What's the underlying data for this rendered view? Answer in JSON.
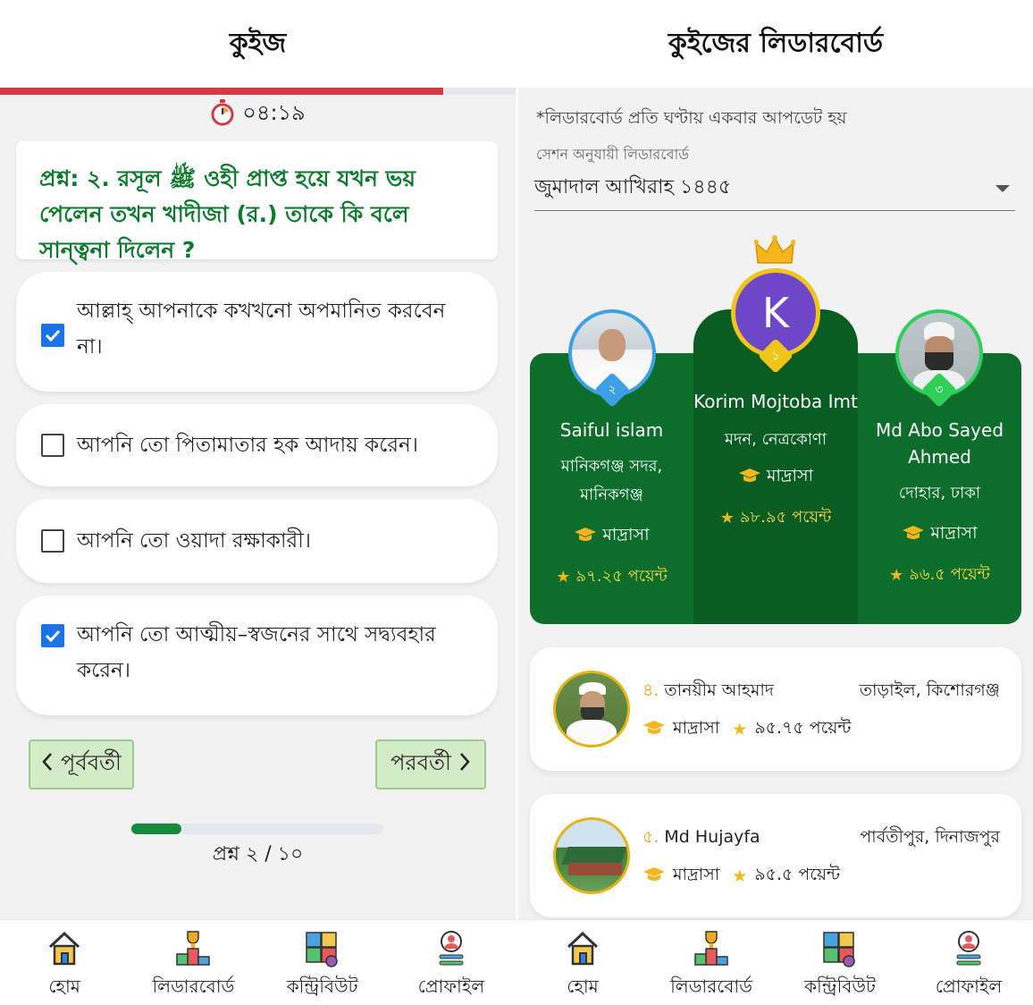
{
  "quiz": {
    "title": "কুইজ",
    "progress_fraction": 0.86,
    "timer": "০৪:১৯",
    "question": "প্রশ্ন: ২. রসূল ﷺ ওহী প্রাপ্ত হয়ে যখন ভয় পেলেন তখন খাদীজা (র.) তাকে কি বলে সান্ত্বনা দিলেন ?",
    "options": [
      {
        "text": "আল্লাহ্ আপনাকে কখখনো অপমানিত করবেন না।",
        "checked": true
      },
      {
        "text": "আপনি তো পিতামাতার হক আদায় করেন।",
        "checked": false
      },
      {
        "text": "আপনি তো ওয়াদা রক্ষাকারী।",
        "checked": false
      },
      {
        "text": "আপনি তো আত্মীয়–স্বজনের সাথে সদ্ব্যবহার করেন।",
        "checked": true
      }
    ],
    "prev_label": "পূর্ববর্তী",
    "next_label": "পরবর্তী",
    "question_progress_fraction": 0.2,
    "question_counter": "প্রশ্ন ২ / ১০"
  },
  "leaderboard": {
    "title": "কুইজের লিডারবোর্ড",
    "note": "*লিডারবোর্ড প্রতি ঘণ্টায় একবার আপডেট হয়",
    "session_label": "সেশন অনুযায়ী লিডারবোর্ড",
    "session_value": "জুমাদাল আখিরাহ ১৪৪৫",
    "podium": {
      "first": {
        "rank": "১",
        "initial": "K",
        "name": "Korim Mojtoba Imt",
        "location": "মদন, নেত্রকোণা",
        "institution": "মাদ্রাসা",
        "points": "৯৮.৯৫ পয়েন্ট"
      },
      "second": {
        "rank": "২",
        "name": "Saiful islam",
        "location": "মানিকগঞ্জ সদর, মানিকগঞ্জ",
        "institution": "মাদ্রাসা",
        "points": "৯৭.২৫ পয়েন্ট"
      },
      "third": {
        "rank": "৩",
        "name": "Md Abo Sayed Ahmed",
        "location": "দোহার, ঢাকা",
        "institution": "মাদ্রাসা",
        "points": "৯৬.৫ পয়েন্ট"
      }
    },
    "ranks": [
      {
        "rank": "৪.",
        "name": "তানয়ীম আহমাদ",
        "location": "তাড়াইল, কিশোরগঞ্জ",
        "institution": "মাদ্রাসা",
        "points": "৯৫.৭৫ পয়েন্ট"
      },
      {
        "rank": "৫.",
        "name": "Md Hujayfa",
        "location": "পার্বতীপুর, দিনাজপুর",
        "institution": "মাদ্রাসা",
        "points": "৯৫.৫ পয়েন্ট"
      }
    ]
  },
  "bottom_nav": [
    {
      "label": "হোম",
      "icon": "home-icon"
    },
    {
      "label": "লিডারবোর্ড",
      "icon": "trophy-podium-icon"
    },
    {
      "label": "কন্ট্রিবিউট",
      "icon": "puzzle-contribute-icon"
    },
    {
      "label": "প্রোফাইল",
      "icon": "profile-icon"
    }
  ],
  "colors": {
    "brand_green": "#0d6e2c",
    "dark_green": "#0a5d22",
    "question_green": "#0b7a2c",
    "timer_red": "#d43a44",
    "gold": "#ffd84a",
    "first_place_purple": "#6d47c7"
  }
}
